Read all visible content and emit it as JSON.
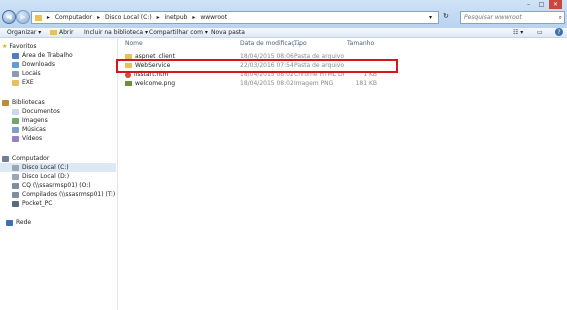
{
  "window": {
    "minimize": "–",
    "maximize": "□",
    "close": "✕"
  },
  "nav": {
    "back": "◀",
    "forward": "▶"
  },
  "address": {
    "segments": [
      "Computador",
      "Disco Local (C:)",
      "inetpub",
      "wwwroot"
    ]
  },
  "search": {
    "placeholder": "Pesquisar wwwroot"
  },
  "toolbar": {
    "organize": "Organizar ▾",
    "open": "Abrir",
    "include": "Incluir na biblioteca ▾",
    "share": "Compartilhar com ▾",
    "new_folder": "Nova pasta"
  },
  "sidebar": {
    "favorites": {
      "label": "Favoritos",
      "items": [
        "Área de Trabalho",
        "Downloads",
        "Locais",
        "EXE"
      ]
    },
    "libraries": {
      "label": "Bibliotecas",
      "items": [
        "Documentos",
        "Imagens",
        "Músicas",
        "Vídeos"
      ]
    },
    "computer": {
      "label": "Computador",
      "items": [
        "Disco Local (C:)",
        "Disco Local (D:)",
        "CQ (\\\\ssasrmsp01) (O:)",
        "Compilados (\\\\ssasrmsp01) (T:)",
        "Pocket_PC"
      ]
    },
    "network": {
      "label": "Rede"
    }
  },
  "columns": {
    "name": "Nome",
    "date": "Data de modificaç...",
    "type": "Tipo",
    "size": "Tamanho"
  },
  "files": [
    {
      "name": "aspnet_client",
      "date": "18/04/2015 08:06",
      "type": "Pasta de arquivos",
      "size": ""
    },
    {
      "name": "WebService",
      "date": "22/03/2016 07:54",
      "type": "Pasta de arquivos",
      "size": ""
    },
    {
      "name": "iisstart.htm",
      "date": "18/04/2015 08:02",
      "type": "Chrome HTML Do...",
      "size": "1 KB"
    },
    {
      "name": "welcome.png",
      "date": "18/04/2015 08:02",
      "type": "Imagem PNG",
      "size": "181 KB"
    }
  ],
  "colors": {
    "highlight_box": "#d6161b",
    "folder": "#e8c15a",
    "accent": "#3a6fb0"
  }
}
